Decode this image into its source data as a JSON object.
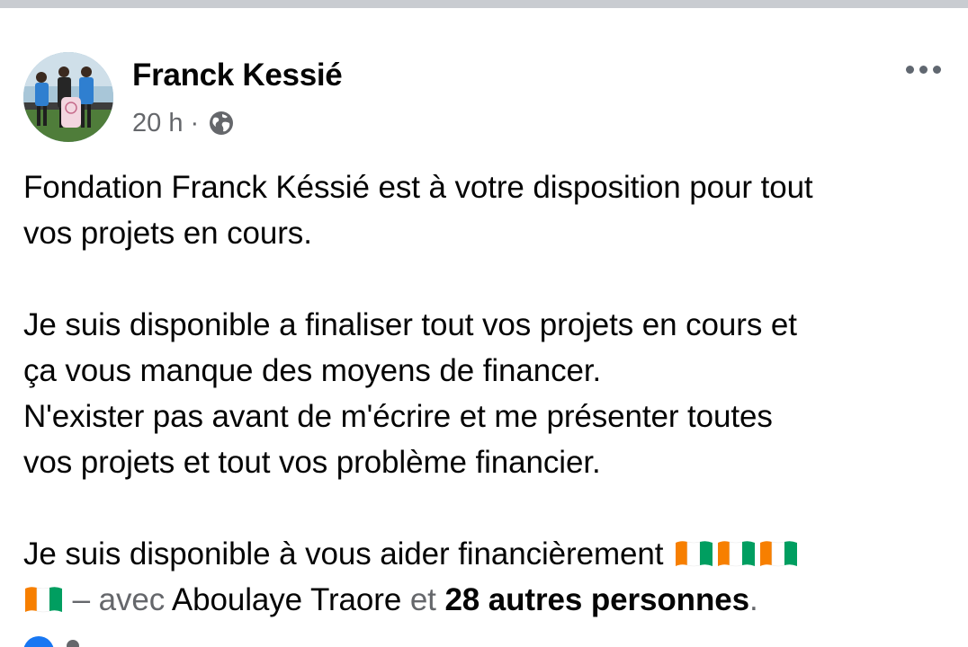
{
  "post": {
    "author": "Franck Kessié",
    "time": "20 h",
    "separator": "·",
    "visibility_icon": "globe-icon",
    "more_icon": "more-options-icon",
    "body": {
      "line1": "Fondation Franck Késsié est à votre disposition pour tout",
      "line2": "vos projets en cours.",
      "line3": "Je suis disponible a finaliser tout vos projets en cours et",
      "line4": "ça vous manque des moyens de financer.",
      "line5": "N'exister pas avant de m'écrire et me présenter toutes",
      "line6": "vos projets et tout vos problème financier.",
      "line7": "Je suis disponible à vous aider  financièrement"
    },
    "tags": {
      "dash": "–",
      "with_label": "avec",
      "person": "Aboulaye Traore",
      "and_label": "et",
      "others": "28 autres personnes",
      "period": "."
    },
    "flags": [
      "flag-cote-divoire-icon",
      "flag-cote-divoire-icon",
      "flag-cote-divoire-icon",
      "flag-cote-divoire-icon"
    ]
  },
  "colors": {
    "text": "#050505",
    "secondary": "#65676b",
    "flag_orange": "#f77f00",
    "flag_white": "#ffffff",
    "flag_green": "#009e60",
    "reaction_blue": "#1877f2"
  }
}
